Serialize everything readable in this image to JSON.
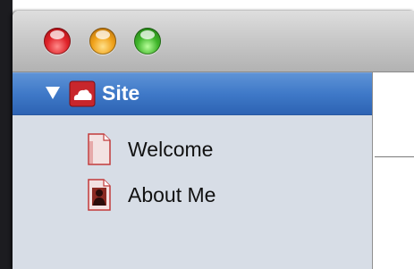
{
  "sidebar": {
    "items": [
      {
        "label": "Site",
        "icon": "site-cloud-icon",
        "expanded": true,
        "selected": true
      },
      {
        "label": "Welcome",
        "icon": "page-icon",
        "selected": false
      },
      {
        "label": "About Me",
        "icon": "profile-page-icon",
        "selected": false
      }
    ]
  },
  "colors": {
    "selection": "#3f79c8",
    "sidebar_bg": "#d7dde6"
  }
}
